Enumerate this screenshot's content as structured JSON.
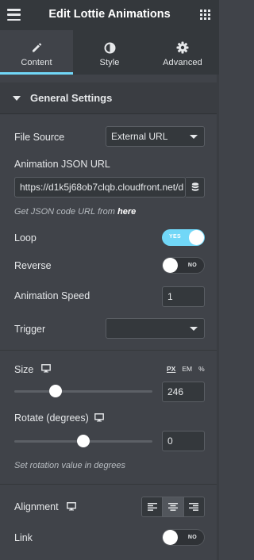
{
  "header": {
    "title": "Edit Lottie Animations",
    "menu_icon": "hamburger-icon",
    "apps_icon": "grid-icon"
  },
  "tabs": [
    {
      "label": "Content",
      "icon": "pencil-icon",
      "active": true
    },
    {
      "label": "Style",
      "icon": "half-circle-icon",
      "active": false
    },
    {
      "label": "Advanced",
      "icon": "gear-icon",
      "active": false
    }
  ],
  "section": {
    "title": "General Settings"
  },
  "fields": {
    "file_source": {
      "label": "File Source",
      "value": "External URL"
    },
    "json_url": {
      "label": "Animation JSON URL",
      "value": "https://d1k5j68ob7clqb.cloudfront.net/d"
    },
    "json_hint": {
      "prefix": "Get JSON code URL from",
      "link": "here"
    },
    "loop": {
      "label": "Loop",
      "state": "YES",
      "on": true
    },
    "reverse": {
      "label": "Reverse",
      "state": "NO",
      "on": false
    },
    "speed": {
      "label": "Animation Speed",
      "value": "1"
    },
    "trigger": {
      "label": "Trigger",
      "value": ""
    },
    "size": {
      "label": "Size",
      "value": "246",
      "units": [
        "PX",
        "EM",
        "%"
      ],
      "active_unit": "PX",
      "slider_fraction": 0.3
    },
    "rotate": {
      "label": "Rotate (degrees)",
      "value": "0",
      "slider_fraction": 0.5
    },
    "rotate_hint": "Set rotation value in degrees",
    "alignment": {
      "label": "Alignment",
      "options": [
        "align-left-icon",
        "align-center-icon",
        "align-right-icon"
      ],
      "active": "align-center-icon"
    },
    "link": {
      "label": "Link",
      "state": "NO",
      "on": false
    }
  },
  "colors": {
    "accent": "#71d7f7",
    "panel_bg": "#404349",
    "header_bg": "#34383c"
  }
}
